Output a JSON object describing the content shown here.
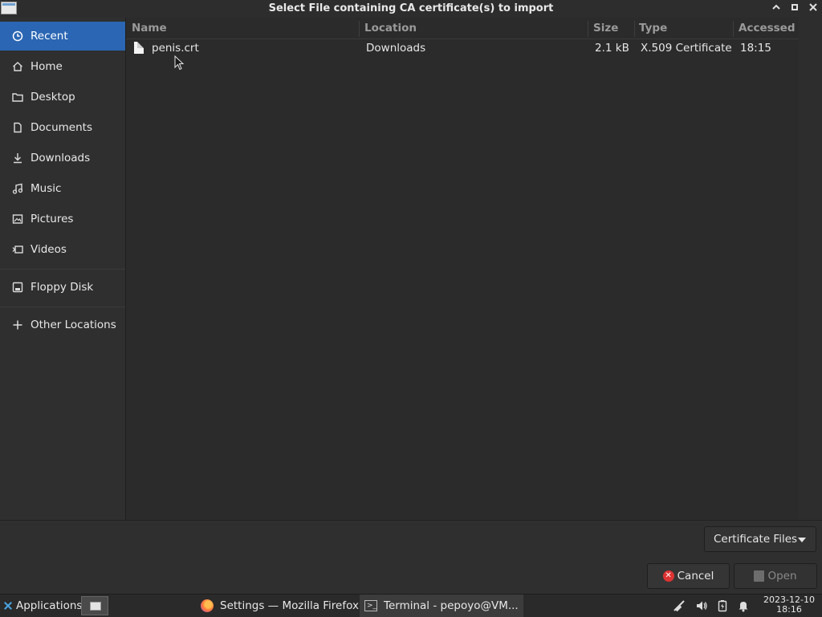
{
  "window": {
    "title": "Select File containing CA certificate(s) to import"
  },
  "sidebar": {
    "items": [
      {
        "label": "Recent",
        "icon": "clock-icon",
        "active": true
      },
      {
        "label": "Home",
        "icon": "home-icon"
      },
      {
        "label": "Desktop",
        "icon": "folder-icon"
      },
      {
        "label": "Documents",
        "icon": "document-icon"
      },
      {
        "label": "Downloads",
        "icon": "download-icon"
      },
      {
        "label": "Music",
        "icon": "music-icon"
      },
      {
        "label": "Pictures",
        "icon": "picture-icon"
      },
      {
        "label": "Videos",
        "icon": "video-icon"
      },
      {
        "label": "Floppy Disk",
        "icon": "floppy-icon"
      },
      {
        "label": "Other Locations",
        "icon": "plus-icon"
      }
    ]
  },
  "filelist": {
    "columns": [
      "Name",
      "Location",
      "Size",
      "Type",
      "Accessed"
    ],
    "rows": [
      {
        "name": "penis.crt",
        "location": "Downloads",
        "size": "2.1 kB",
        "type": "X.509 Certificate",
        "accessed": "18:15"
      }
    ]
  },
  "footer": {
    "filter_label": "Certificate Files",
    "cancel_label": "Cancel",
    "open_label": "Open"
  },
  "taskbar": {
    "applications_label": "Applications",
    "windows": [
      {
        "label": "Settings — Mozilla Firefox",
        "icon": "firefox-icon"
      },
      {
        "label": "Terminal - pepoyo@VM...",
        "icon": "terminal-icon"
      }
    ],
    "clock_date": "2023-12-10",
    "clock_time": "18:16"
  },
  "colors": {
    "accent": "#2a66b3",
    "background": "#2b2b2b"
  }
}
